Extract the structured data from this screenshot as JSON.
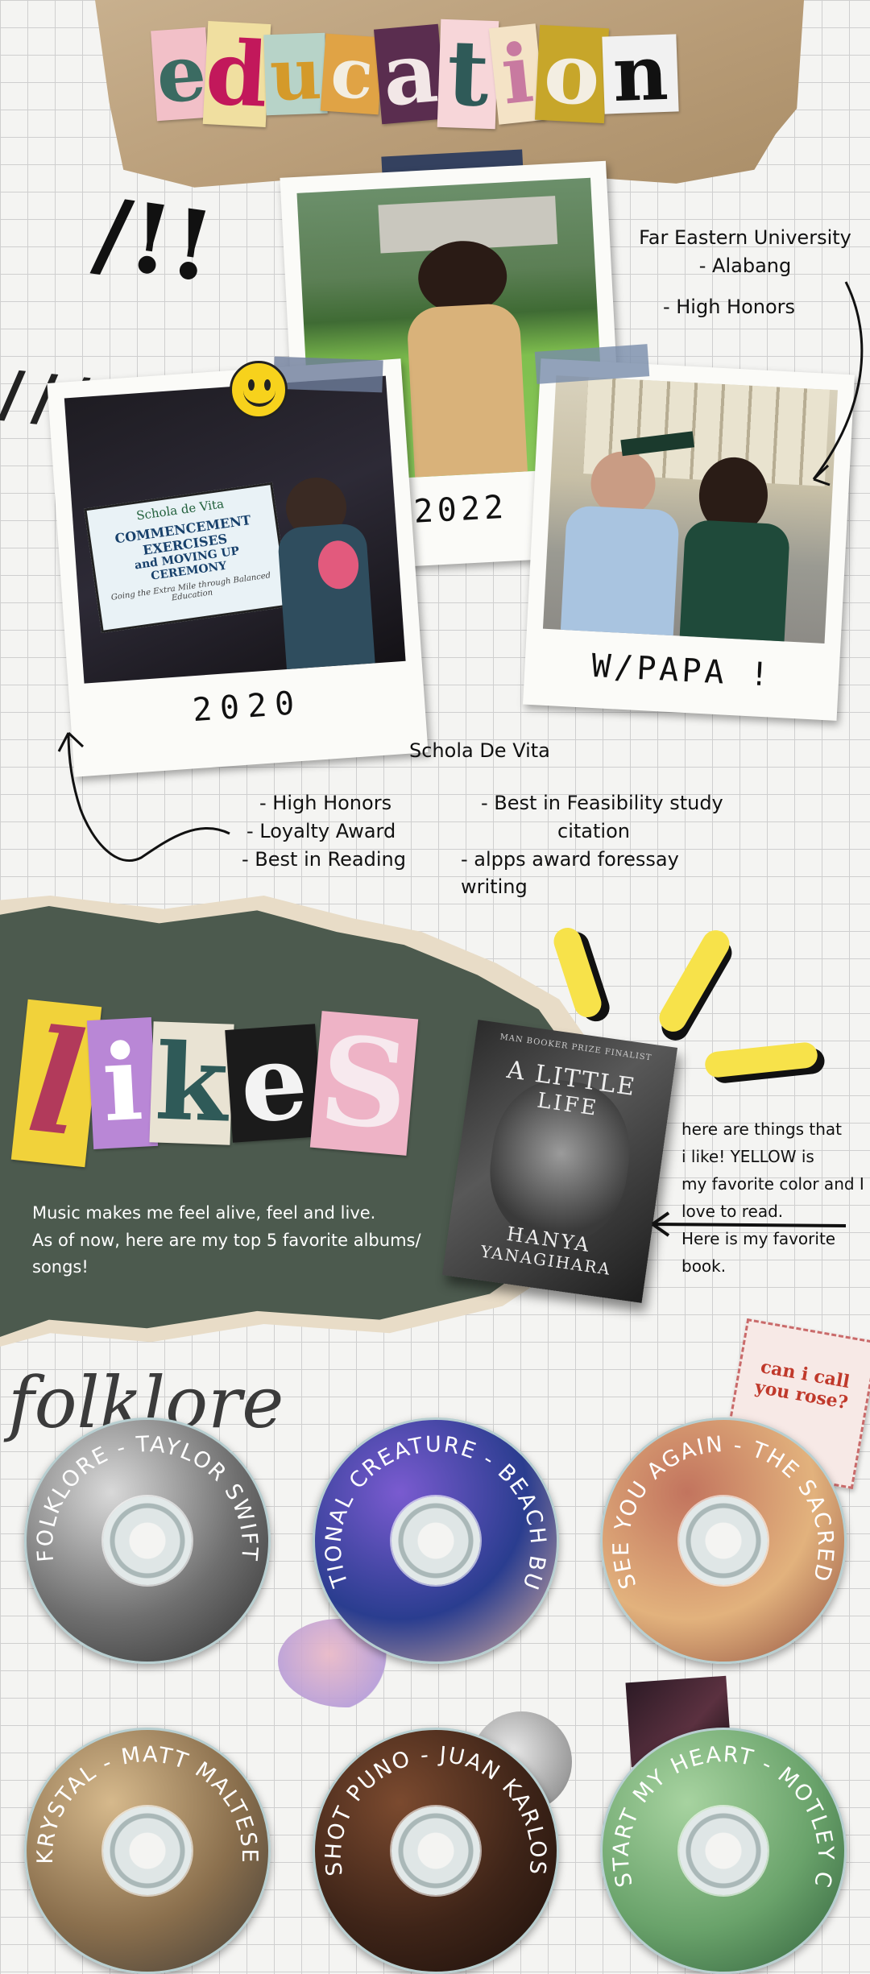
{
  "header": {
    "title_letters": [
      {
        "ch": "e",
        "bg": "#f2c0c8",
        "fg": "#3b6b62"
      },
      {
        "ch": "d",
        "bg": "#f0dfa0",
        "fg": "#c2185b"
      },
      {
        "ch": "u",
        "bg": "#b7d3c8",
        "fg": "#d49a2a"
      },
      {
        "ch": "c",
        "bg": "#e0a345",
        "fg": "#f3eee2"
      },
      {
        "ch": "a",
        "bg": "#5a2d4f",
        "fg": "#f2e7e7"
      },
      {
        "ch": "t",
        "bg": "#f7d6d9",
        "fg": "#2f5a58"
      },
      {
        "ch": "i",
        "bg": "#f4e3c6",
        "fg": "#c87aa0"
      },
      {
        "ch": "o",
        "bg": "#c7a62a",
        "fg": "#f3eee2"
      },
      {
        "ch": "n",
        "bg": "#f1f1f1",
        "fg": "#111111"
      }
    ]
  },
  "decor": {
    "exclaim": "/!!",
    "hash": "////"
  },
  "polaroids": {
    "p2020": {
      "caption": "2020",
      "banner_school": "Schola de Vita",
      "banner_line1": "COMMENCEMENT EXERCISES",
      "banner_line2": "and MOVING UP CEREMONY",
      "banner_sub": "Going the Extra Mile through Balanced Education"
    },
    "p2022": {
      "caption": "2022"
    },
    "papa": {
      "caption": "W/PAPA !"
    }
  },
  "feu": {
    "line1": "Far Eastern University",
    "line2": "- Alabang",
    "honor": "- High Honors"
  },
  "schola": {
    "name": "Schola De Vita",
    "left": [
      "- High Honors",
      "- Loyalty Award",
      "- Best in Reading"
    ],
    "right1": "- Best in Feasibility study",
    "right2": "citation",
    "right3": "- alpps award foressay writing"
  },
  "likes": {
    "title_letters": [
      {
        "ch": "l",
        "bg": "#f1d23a",
        "fg": "#b23a5b"
      },
      {
        "ch": "i",
        "bg": "#b987d6",
        "fg": "#ffffff"
      },
      {
        "ch": "k",
        "bg": "#e9e3d3",
        "fg": "#2f5a58"
      },
      {
        "ch": "e",
        "bg": "#1b1b1b",
        "fg": "#f3f3f3"
      },
      {
        "ch": "S",
        "bg": "#eeb3c6",
        "fg": "#f7e9ee"
      }
    ],
    "music_line1": "Music makes me feel alive, feel and live.",
    "music_line2": "As of now, here are my top 5 favorite albums/",
    "music_line3": "songs!",
    "right_note": [
      "here are things that",
      "i like! YELLOW is",
      "my favorite color and I",
      "love to read.",
      "Here is my favorite",
      "book."
    ]
  },
  "book": {
    "top": "MAN BOOKER PRIZE FINALIST",
    "title1": "A LITTLE",
    "title2": "LIFE",
    "author1": "HANYA",
    "author2": "YANAGIHARA"
  },
  "sticker": {
    "text": "can i call you rose?"
  },
  "folklore_script": "folklore",
  "cds": [
    {
      "label": "FOLKLORE - TAYLOR SWIFT",
      "c1": "#d9d9d9",
      "c2": "#6f6f6f",
      "c3": "#2e2e2e"
    },
    {
      "label": "EMOTIONAL CREATURE - BEACH BUNNY",
      "c1": "#7a5bd0",
      "c2": "#2a3d8f",
      "c3": "#e7b7a0"
    },
    {
      "label": "WILL I SEE YOU AGAIN - THE SACRED SOULS",
      "c1": "#c2745e",
      "c2": "#e2b27d",
      "c3": "#8d4b3d"
    },
    {
      "label": "KRYSTAL - MATT MALTESE",
      "c1": "#d6b98c",
      "c2": "#8a6f4d",
      "c3": "#3f3a35"
    },
    {
      "label": "SHOT PUNO - JUAN KARLOS",
      "c1": "#7b4a2f",
      "c2": "#3e2418",
      "c3": "#1b0f0a"
    },
    {
      "label": "KICKSTART MY HEART - MOTLEY CREW",
      "c1": "#a7d3a0",
      "c2": "#6aa36b",
      "c3": "#2f5e3a"
    }
  ]
}
